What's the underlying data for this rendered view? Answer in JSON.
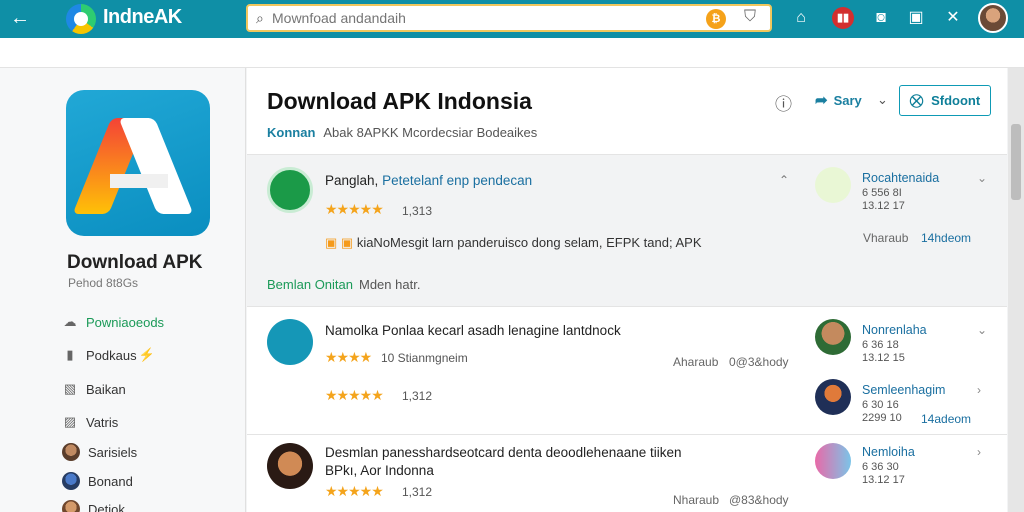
{
  "topbar": {
    "app_name": "IndneAK",
    "search": {
      "placeholder": "Mownfoad andandaih",
      "value": ""
    },
    "icons": [
      "back-arrow-icon",
      "logo-icon",
      "search-icon",
      "notification-badge-icon",
      "shield-icon",
      "home-icon",
      "red-app-icon",
      "camera-icon",
      "window-icon",
      "close-icon",
      "user-avatar"
    ]
  },
  "sidebar": {
    "title": "Download APK",
    "subtitle": "Pehod 8t8Gs",
    "items": [
      {
        "label": "Powniaoeods",
        "active": true
      },
      {
        "label": "Podkaus"
      },
      {
        "label": "Baikan"
      },
      {
        "label": "Vatris"
      },
      {
        "label": "Sarisiels"
      },
      {
        "label": "Bonand"
      },
      {
        "label": "Detiok"
      }
    ]
  },
  "main": {
    "title": "Download APK Indonsia",
    "breadcrumb": {
      "first": "Konnan",
      "rest": "Abak 8APKK Mcordecsiar Bodeaikes"
    },
    "share_label": "Sary",
    "support_label": "Sfdoont",
    "featured": {
      "title_lead": "Panglah,",
      "title_rest": "Petetelanf enp pendecan",
      "rating": "1,313",
      "desc": "kiaNoMesgit larn panderuisco dong selam, EFPK tand; APK",
      "section_label_1": "Bemlan Onitan",
      "section_label_2": "Mden hatr.",
      "publisher": {
        "name": "Rocahtenaida",
        "line1": "6 556 8I",
        "line2": "13.12 17",
        "meta_left": "Vharaub",
        "meta_right": "14hdeom"
      }
    },
    "apps": [
      {
        "title": "Namolka Ponlaa kecarl asadh lenagine lantdnock",
        "rating_text": "10 Stianmgneim",
        "rating2": "1,312",
        "meta_a": "Aharaub",
        "meta_b": "0@3&hody",
        "publishers": [
          {
            "name": "Nonrenlaha",
            "line1": "6 36 18",
            "line2": "13.12 15"
          },
          {
            "name": "Semleenhagim",
            "line1": "6 30 16",
            "line2": "2299 10",
            "link": "14adeom"
          }
        ]
      },
      {
        "title": "Desmlan panesshardseotcard denta deoodlehenaane tiiken",
        "subtitle": "BPkı, Aor Indonna",
        "rating": "1,312",
        "meta_a": "Nharaub",
        "meta_b": "@83&hody",
        "publisher": {
          "name": "Nemloiha",
          "line1": "6 36 30",
          "line2": "13.12 17"
        }
      }
    ]
  },
  "colors": {
    "topbar": "#0f8fa6",
    "accent_green": "#1b9a58",
    "star": "#f4a41c",
    "link_blue": "#1a6fa0"
  }
}
